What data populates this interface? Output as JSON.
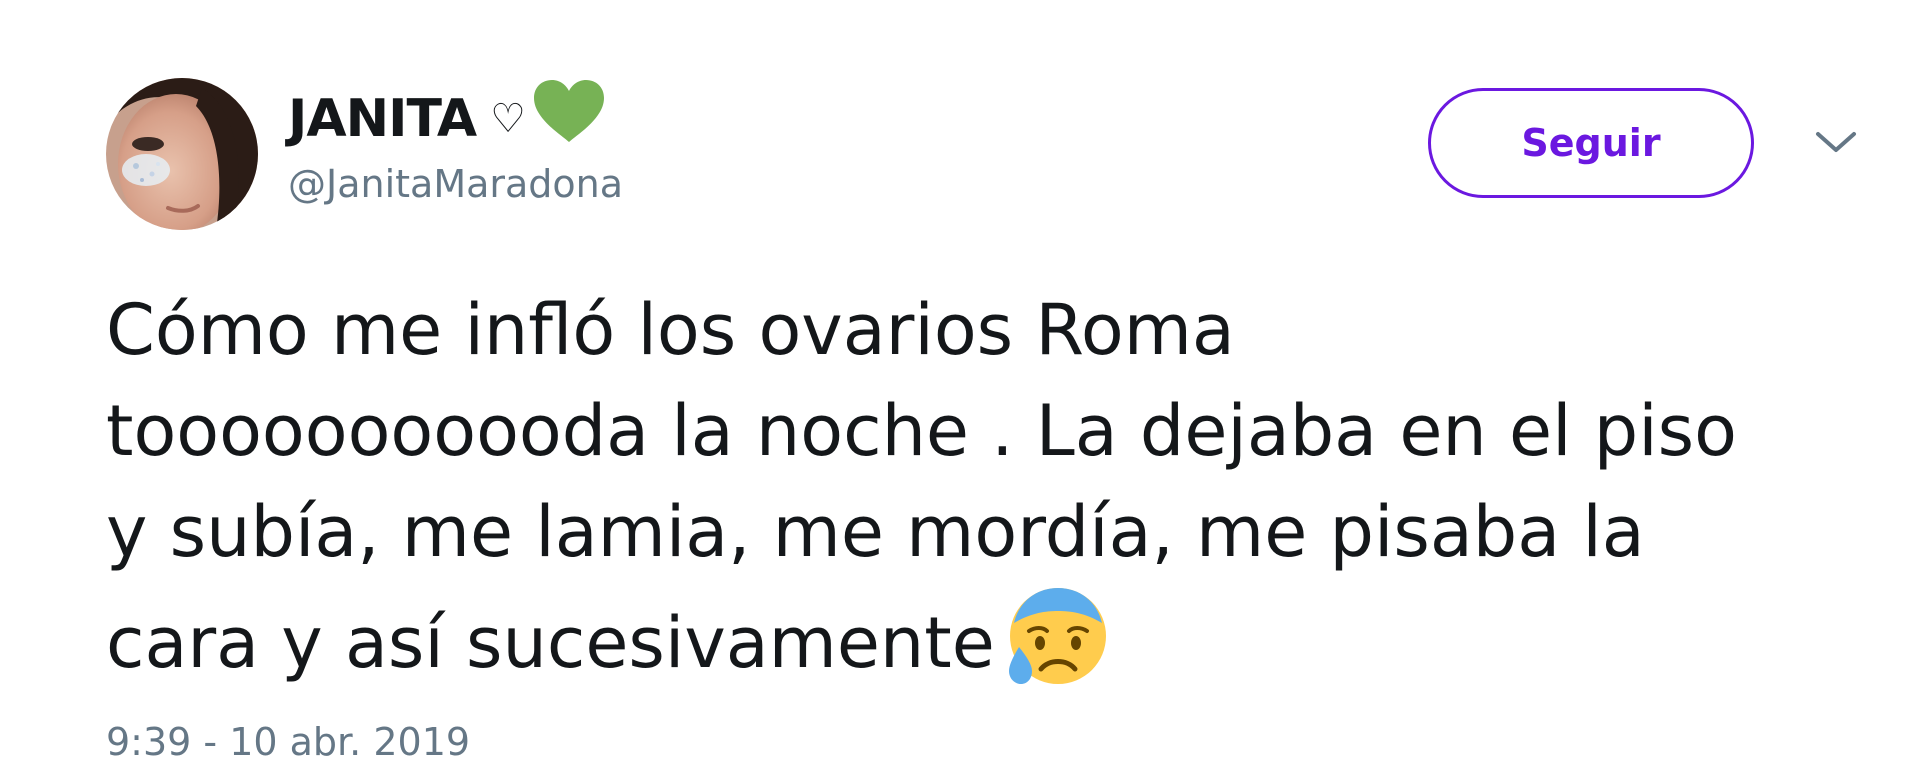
{
  "user": {
    "display_name": "JANITA",
    "outline_heart": "♡",
    "green_heart_icon": "green-heart-emoji",
    "handle": "@JanitaMaradona",
    "avatar_icon": "profile-photo"
  },
  "actions": {
    "follow_label": "Seguir",
    "more_icon": "chevron-down-icon"
  },
  "tweet": {
    "lines": [
      "Cómo me infló los ovarios Roma",
      "tooooooooooda la noche . La dejaba en el piso",
      "y subía, me lamia, me mordía, me pisaba la",
      "cara y así sucesivamente"
    ],
    "emoji": "anxious-face-with-sweat-emoji",
    "timestamp": "9:39 - 10 abr. 2019"
  },
  "colors": {
    "follow_accent": "#6b18e0",
    "secondary_text": "#657786",
    "primary_text": "#14171a",
    "green_heart": "#77b255"
  }
}
